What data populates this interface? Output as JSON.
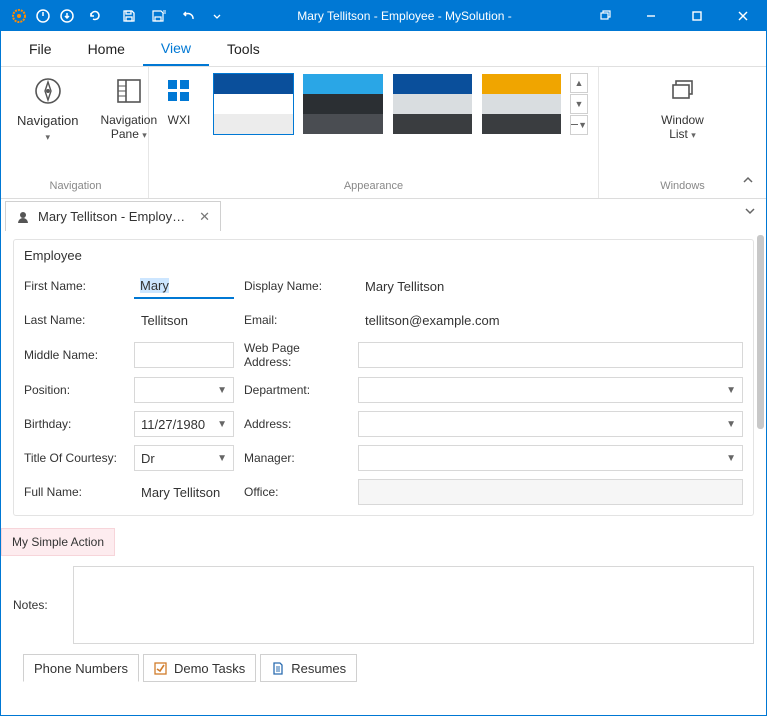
{
  "title": "Mary Tellitson - Employee - MySolution -",
  "menu": {
    "file": "File",
    "home": "Home",
    "view": "View",
    "tools": "Tools",
    "active": "view"
  },
  "ribbon": {
    "nav": {
      "navigation": "Navigation",
      "pane": "Navigation\nPane",
      "group_label": "Navigation"
    },
    "wxi": {
      "label": "WXI"
    },
    "appearance": {
      "group_label": "Appearance",
      "themes": [
        {
          "rows": [
            "#0a4f9b",
            "#ffffff",
            "#ececec"
          ],
          "selected": true
        },
        {
          "rows": [
            "#2aa6e6",
            "#2b2f33",
            "#4a4d52"
          ],
          "selected": false
        },
        {
          "rows": [
            "#0a4f9b",
            "#d9dde0",
            "#3a3d40"
          ],
          "selected": false
        },
        {
          "rows": [
            "#f0a500",
            "#d9dde0",
            "#3a3d40"
          ],
          "selected": false
        }
      ]
    },
    "windows": {
      "label": "Window\nList",
      "group_label": "Windows"
    }
  },
  "tab": {
    "label": "Mary Tellitson - Employ…"
  },
  "group": {
    "title": "Employee"
  },
  "fields": {
    "first_name": {
      "label": "First Name:",
      "value": "Mary"
    },
    "last_name": {
      "label": "Last Name:",
      "value": "Tellitson"
    },
    "middle_name": {
      "label": "Middle Name:",
      "value": ""
    },
    "position": {
      "label": "Position:",
      "value": ""
    },
    "birthday": {
      "label": "Birthday:",
      "value": "11/27/1980"
    },
    "title_courtesy": {
      "label": "Title Of Courtesy:",
      "value": "Dr"
    },
    "full_name": {
      "label": "Full Name:",
      "value": "Mary Tellitson"
    },
    "display_name": {
      "label": "Display Name:",
      "value": "Mary Tellitson"
    },
    "email": {
      "label": "Email:",
      "value": "tellitson@example.com"
    },
    "web": {
      "label": "Web Page Address:",
      "value": ""
    },
    "department": {
      "label": "Department:",
      "value": ""
    },
    "address": {
      "label": "Address:",
      "value": ""
    },
    "manager": {
      "label": "Manager:",
      "value": ""
    },
    "office": {
      "label": "Office:",
      "value": ""
    }
  },
  "action": {
    "label": "My Simple Action"
  },
  "notes": {
    "label": "Notes:"
  },
  "bottom_tabs": {
    "phone": "Phone Numbers",
    "demo": "Demo Tasks",
    "resumes": "Resumes"
  }
}
